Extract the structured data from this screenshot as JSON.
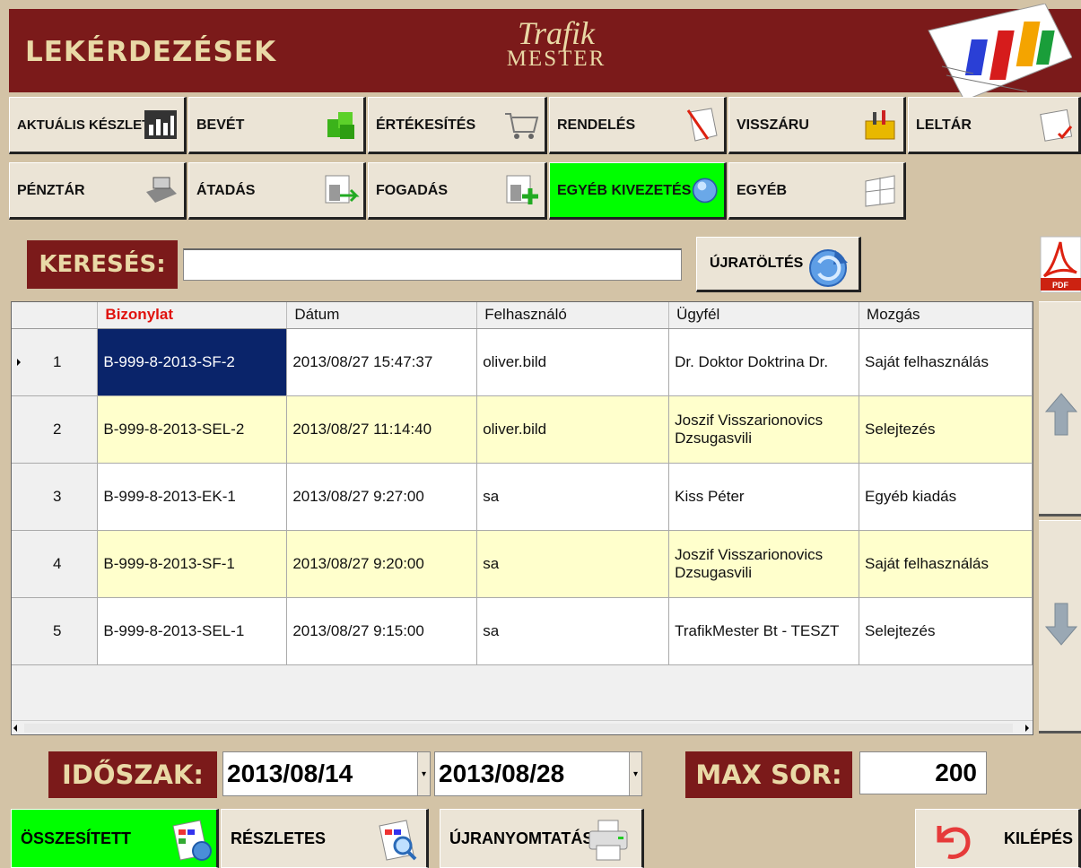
{
  "header": {
    "title": "LEKÉRDEZÉSEK",
    "logo_line1": "Trafik",
    "logo_line2": "MESTER"
  },
  "toolbar": {
    "row1": [
      "AKTUÁLIS KÉSZLET",
      "BEVÉT",
      "ÉRTÉKESÍTÉS",
      "RENDELÉS",
      "VISSZÁRU",
      "LELTÁR"
    ],
    "row2": [
      "PÉNZTÁR",
      "ÁTADÁS",
      "FOGADÁS",
      "EGYÉB KIVEZETÉS",
      "EGYÉB"
    ],
    "active": "EGYÉB KIVEZETÉS",
    "active_color": "#00ff00"
  },
  "search": {
    "label": "KERESÉS:",
    "value": "",
    "reload_label": "ÚJRATÖLTÉS"
  },
  "grid": {
    "columns": [
      "Bizonylat",
      "Dátum",
      "Felhasználó",
      "Ügyfél",
      "Mozgás"
    ],
    "sorted_column": "Bizonylat",
    "rows": [
      {
        "no": "1",
        "bizonylat": "B-999-8-2013-SF-2",
        "datum": "2013/08/27 15:47:37",
        "felhasznalo": "oliver.bild",
        "ugyfel": "Dr. Doktor Doktrina Dr.",
        "mozgas": "Saját felhasználás"
      },
      {
        "no": "2",
        "bizonylat": "B-999-8-2013-SEL-2",
        "datum": "2013/08/27 11:14:40",
        "felhasznalo": "oliver.bild",
        "ugyfel": "Joszif Visszarionovics Dzsugasvili",
        "mozgas": "Selejtezés"
      },
      {
        "no": "3",
        "bizonylat": "B-999-8-2013-EK-1",
        "datum": "2013/08/27 9:27:00",
        "felhasznalo": "sa",
        "ugyfel": "Kiss Péter",
        "mozgas": "Egyéb kiadás"
      },
      {
        "no": "4",
        "bizonylat": "B-999-8-2013-SF-1",
        "datum": "2013/08/27 9:20:00",
        "felhasznalo": "sa",
        "ugyfel": "Joszif Visszarionovics Dzsugasvili",
        "mozgas": "Saját felhasználás"
      },
      {
        "no": "5",
        "bizonylat": "B-999-8-2013-SEL-1",
        "datum": "2013/08/27 9:15:00",
        "felhasznalo": "sa",
        "ugyfel": "TrafikMester Bt - TESZT",
        "mozgas": "Selejtezés"
      }
    ],
    "selected_row_color": "#0a246a",
    "alt_row_color": "#ffffcc"
  },
  "period": {
    "label": "IDŐSZAK:",
    "from": "2013/08/14",
    "to": "2013/08/28"
  },
  "max_rows": {
    "label": "MAX SOR:",
    "value": "200"
  },
  "bottom": {
    "summary": "ÖSSZESÍTETT",
    "detailed": "RÉSZLETES",
    "reprint": "ÚJRANYOMTATÁS",
    "exit": "KILÉPÉS"
  },
  "colors": {
    "header_bg": "#7b1a1a",
    "header_text": "#e9d9a6",
    "page_bg": "#d3c3a6",
    "sorted_header": "#e0120e"
  },
  "icons": [
    "bar-chart-icon",
    "green-boxes-icon",
    "shopping-cart-icon",
    "order-form-icon",
    "toolbox-icon",
    "checklist-icon",
    "cash-register-icon",
    "transfer-icon",
    "receive-icon",
    "info-icon",
    "windows-icon",
    "refresh-icon",
    "pdf-icon",
    "up-arrow-icon",
    "down-arrow-icon",
    "report-icon",
    "magnifier-icon",
    "printer-icon",
    "undo-icon"
  ]
}
